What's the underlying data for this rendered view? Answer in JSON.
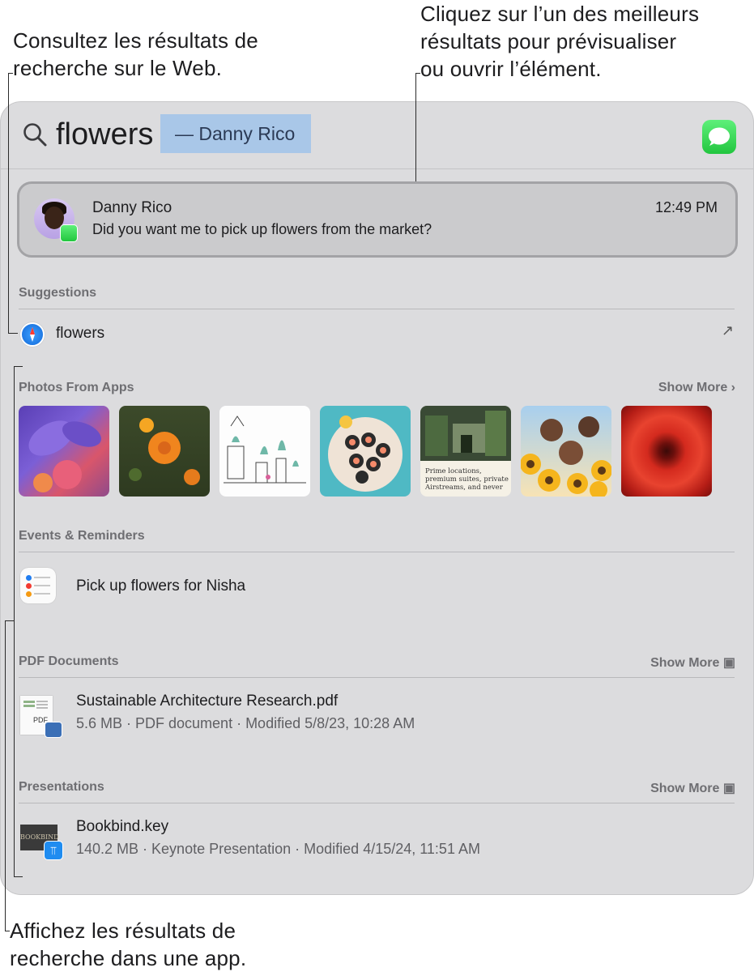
{
  "callouts": {
    "web_results": [
      "Consultez les résultats de",
      "recherche sur le Web."
    ],
    "top_hit": [
      "Cliquez sur l’un des meilleurs",
      "résultats pour prévisualiser",
      "ou ouvrir l’élément."
    ],
    "in_app": [
      "Affichez les résultats de",
      "recherche dans une app."
    ]
  },
  "search": {
    "query": "flowers",
    "completion": "— Danny Rico",
    "icon": "search-icon",
    "app_icon": "messages-icon"
  },
  "top_hit": {
    "name": "Danny Rico",
    "message": "Did you want me to pick up flowers from the market?",
    "time": "12:49 PM"
  },
  "suggestions": {
    "header": "Suggestions",
    "item": "flowers",
    "icon": "safari-icon"
  },
  "photos": {
    "header": "Photos From Apps",
    "show_more": "Show More",
    "items": [
      "iris-flowers",
      "orange-marigold",
      "plant-sketch",
      "sushi-plate",
      "prime-locations-article",
      "sunflower-friends",
      "red-gerbera"
    ],
    "article_text": "Prime locations, premium suites, private Airstreams, and never"
  },
  "events": {
    "header": "Events & Reminders",
    "item": "Pick up flowers for Nisha"
  },
  "pdfs": {
    "header": "PDF Documents",
    "show_more": "Show More",
    "title": "Sustainable Architecture Research.pdf",
    "meta": "5.6 MB · PDF document · Modified 5/8/23, 10:28 AM",
    "icon_label": "PDF"
  },
  "presentations": {
    "header": "Presentations",
    "show_more": "Show More",
    "title": "Bookbind.key",
    "meta": "140.2 MB · Keynote Presentation · Modified 4/15/24, 11:51 AM",
    "thumb_text": "BOOKBIND"
  }
}
